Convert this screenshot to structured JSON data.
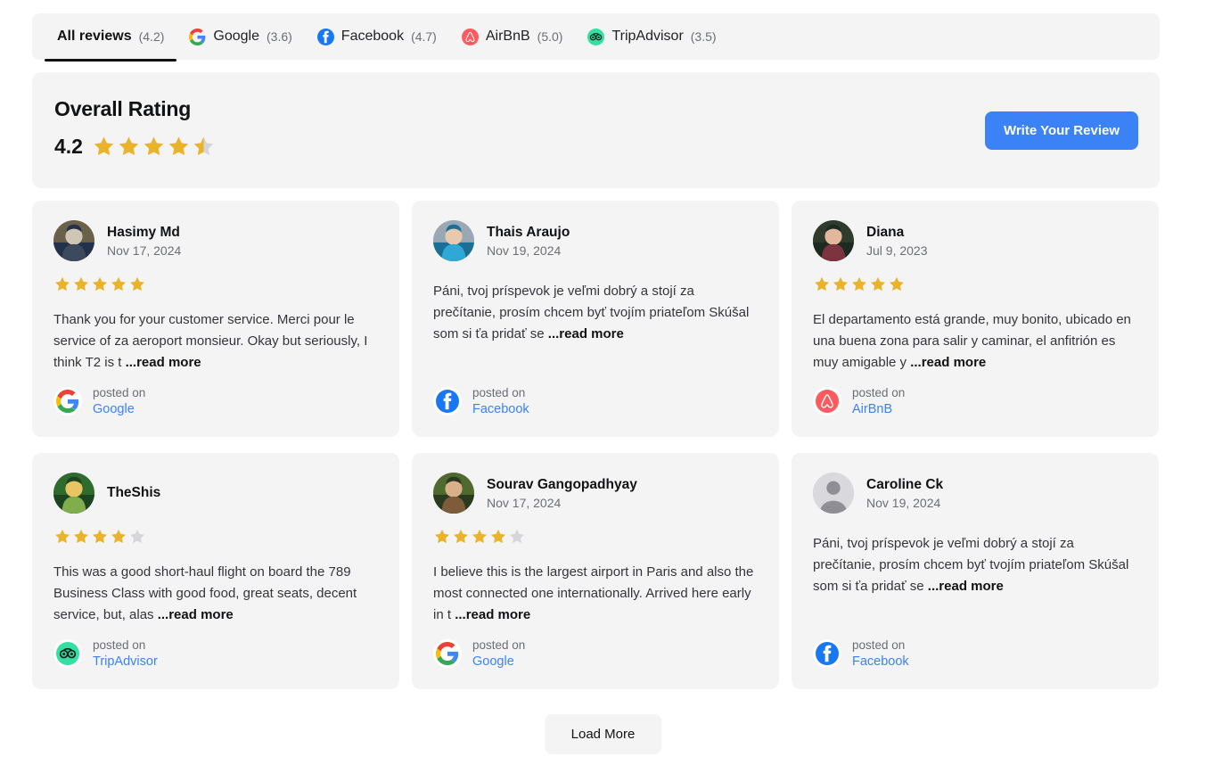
{
  "tabs": [
    {
      "id": "all",
      "label": "All reviews",
      "score": "(4.2)",
      "icon": "none",
      "active": true
    },
    {
      "id": "google",
      "label": "Google",
      "score": "(3.6)",
      "icon": "google-icon",
      "active": false
    },
    {
      "id": "facebook",
      "label": "Facebook",
      "score": "(4.7)",
      "icon": "facebook-icon",
      "active": false
    },
    {
      "id": "airbnb",
      "label": "AirBnB",
      "score": "(5.0)",
      "icon": "airbnb-icon",
      "active": false
    },
    {
      "id": "tripadvisor",
      "label": "TripAdvisor",
      "score": "(3.5)",
      "icon": "tripadvisor-icon",
      "active": false
    }
  ],
  "overall": {
    "title": "Overall Rating",
    "score": "4.2",
    "stars": 4.5,
    "write_review_label": "Write Your Review"
  },
  "reviews": [
    {
      "name": "Hasimy Md",
      "date": "Nov 17, 2024",
      "stars": 5,
      "text": "Thank you for your customer service. Merci pour le service of za aeroport monsieur. Okay but seriously, I think T2 is t ",
      "read_more": "...read more",
      "posted_on": "posted on",
      "source": "Google",
      "source_icon": "google-icon",
      "avatar": "photo-man-white-cap"
    },
    {
      "name": "Thais Araujo",
      "date": "Nov 19, 2024",
      "stars": 0,
      "text": "Páni, tvoj príspevok je veľmi dobrý a stojí za prečítanie, prosím chcem byť tvojím priateľom Skúšal som si ťa pridať se ",
      "read_more": "...read more",
      "posted_on": "posted on",
      "source": "Facebook",
      "source_icon": "facebook-icon",
      "avatar": "photo-woman-sunglasses-blue-scarf"
    },
    {
      "name": "Diana",
      "date": "Jul 9, 2023",
      "stars": 5,
      "text": "El departamento está grande, muy bonito, ubicado en una buena zona para salir y caminar, el anfitrión es muy amigable y ",
      "read_more": "...read more",
      "posted_on": "posted on",
      "source": "AirBnB",
      "source_icon": "airbnb-icon",
      "avatar": "photo-woman-dark-hair"
    },
    {
      "name": "TheShis",
      "date": "",
      "stars": 4,
      "text": "This was a good short-haul flight on board the 789 Business Class with good food, great seats, decent service, but, alas ",
      "read_more": "...read more",
      "posted_on": "posted on",
      "source": "TripAdvisor",
      "source_icon": "tripadvisor-icon",
      "avatar": "photo-green-house"
    },
    {
      "name": "Sourav Gangopadhyay",
      "date": "Nov 17, 2024",
      "stars": 4,
      "text": "I believe this is the largest airport in Paris and also the most connected one internationally. Arrived here early in t ",
      "read_more": "...read more",
      "posted_on": "posted on",
      "source": "Google",
      "source_icon": "google-icon",
      "avatar": "photo-man-beard"
    },
    {
      "name": "Caroline Ck",
      "date": "Nov 19, 2024",
      "stars": 0,
      "text": "Páni, tvoj príspevok je veľmi dobrý a stojí za prečítanie, prosím chcem byť tvojím priateľom Skúšal som si ťa pridať se ",
      "read_more": "...read more",
      "posted_on": "posted on",
      "source": "Facebook",
      "source_icon": "facebook-icon",
      "avatar": "placeholder-person"
    }
  ],
  "load_more_label": "Load More",
  "colors": {
    "accent_blue": "#3b82f6",
    "star_gold": "#e9b429",
    "star_grey": "#d6d6da",
    "card_bg": "#f4f4f5",
    "page_bg": "#ffffff",
    "text_primary": "#111214",
    "text_muted": "#6b6e76",
    "airbnb_pink": "#ff5a5f",
    "tripadvisor_green": "#34e0a1",
    "facebook_blue": "#1877f2"
  }
}
